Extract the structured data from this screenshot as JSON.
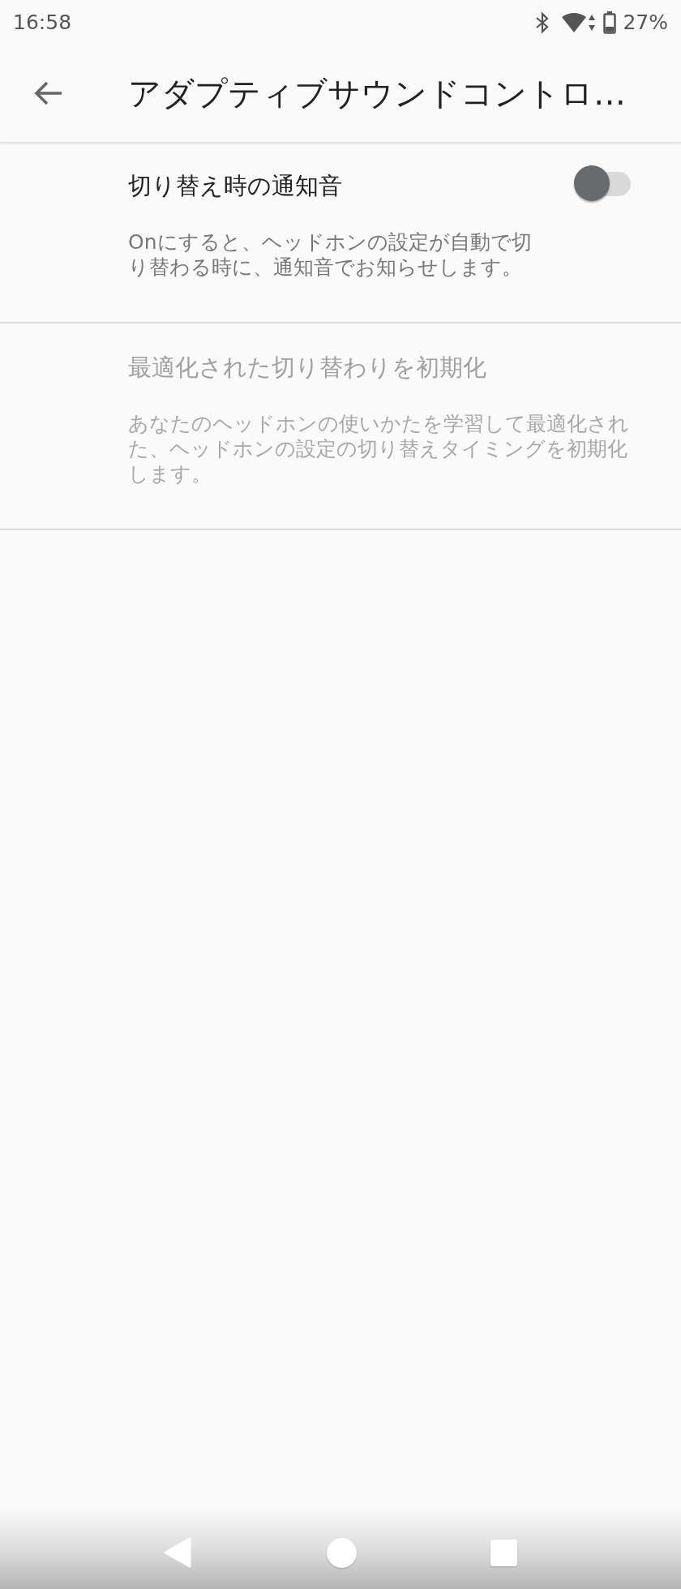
{
  "status_bar": {
    "time": "16:58",
    "battery": "27%"
  },
  "app_bar": {
    "title": "アダプティブサウンドコントロ…"
  },
  "settings": [
    {
      "kind": "switch",
      "title": "切り替え時の通知音",
      "description": "Onにすると、ヘッドホンの設定が自動で切り替わる時に、通知音でお知らせします。",
      "on": false,
      "disabled": false
    },
    {
      "kind": "action",
      "title": "最適化された切り替わりを初期化",
      "description": "あなたのヘッドホンの使いかたを学習して最適化された、ヘッドホンの設定の切り替えタイミングを初期化します。",
      "disabled": true
    }
  ]
}
